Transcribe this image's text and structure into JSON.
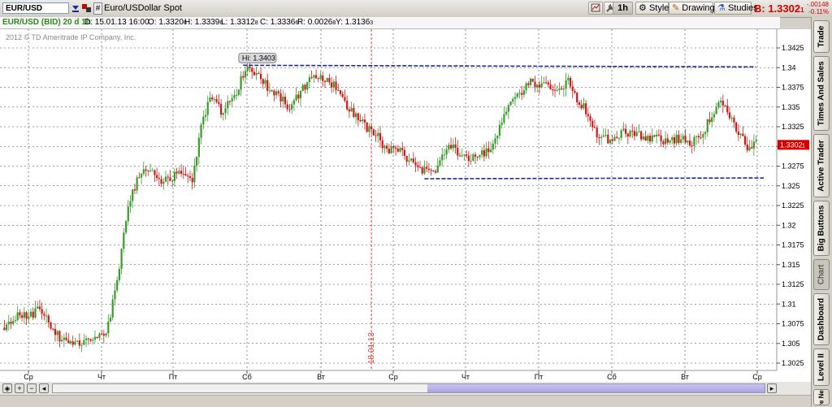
{
  "toolbar": {
    "symbol": "EUR/USD",
    "description": "Euro/USDollar Spot",
    "interval": "1h",
    "style_label": "Style",
    "drawings_label": "Drawings",
    "studies_label": "Studies",
    "bid": "B: 1.3302",
    "bid_suffix": "1",
    "change": "-.00148",
    "change_pct": "-0.11%"
  },
  "info": {
    "symbol_period": "EUR/USD (BID) 20 d 1h",
    "date": "D: 15.01.13 16:00",
    "open": "O: 1.3320",
    "open_suffix": "6",
    "high": "H: 1.3339",
    "high_suffix": "6",
    "low": "L: 1.3312",
    "low_suffix": "8",
    "close": "C: 1.3336",
    "close_suffix": "6",
    "range": "R: 0.0026",
    "range_suffix": "8",
    "y": "Y: 1.3136",
    "y_suffix": "3",
    "copyright": "2012 © TD Ameritrade IP Company, Inc."
  },
  "sidebar": {
    "tabs": [
      "Trade",
      "Times And Sales",
      "Active Trader",
      "Big Buttons",
      "Chart",
      "Dashboard",
      "Level II",
      "Live News"
    ]
  },
  "colors": {
    "up": "#3a9b2c",
    "down": "#d01818",
    "resistance": "#1a2a99",
    "marker": "#e04040",
    "price_tag": "#d40000"
  },
  "chart_data": {
    "type": "candlestick",
    "ylim": [
      1.3025,
      1.3425
    ],
    "y_ticks": [
      "1.3425",
      "1.34",
      "1.3375",
      "1.335",
      "1.3325",
      "1.33",
      "1.3275",
      "1.325",
      "1.3225",
      "1.32",
      "1.3175",
      "1.315",
      "1.3125",
      "1.31",
      "1.3075",
      "1.305",
      "1.3025"
    ],
    "x_ticks": [
      "Ср",
      "Чт",
      "Пт",
      "Сб",
      "Вт",
      "Ср",
      "Чт",
      "Пт",
      "Сб",
      "Вт",
      "Ср"
    ],
    "last_price": "1.3302",
    "last_price_suffix": "1",
    "high_label": "Hi: 1.3403",
    "resistance_level": 1.3403,
    "support_level": 1.3259,
    "date_marker": "18.01.13",
    "date_marker_bar": 166,
    "path": [
      [
        0,
        1.307
      ],
      [
        8,
        1.3088
      ],
      [
        14,
        1.3085
      ],
      [
        16,
        1.3092
      ],
      [
        20,
        1.308
      ],
      [
        26,
        1.3058
      ],
      [
        28,
        1.3052
      ],
      [
        34,
        1.305
      ],
      [
        40,
        1.3055
      ],
      [
        45,
        1.3057
      ],
      [
        48,
        1.3072
      ],
      [
        53,
        1.315
      ],
      [
        57,
        1.322
      ],
      [
        61,
        1.326
      ],
      [
        65,
        1.327
      ],
      [
        69,
        1.3262
      ],
      [
        74,
        1.3256
      ],
      [
        78,
        1.3262
      ],
      [
        82,
        1.3268
      ],
      [
        86,
        1.3252
      ],
      [
        90,
        1.3325
      ],
      [
        94,
        1.336
      ],
      [
        99,
        1.3346
      ],
      [
        103,
        1.3356
      ],
      [
        107,
        1.3376
      ],
      [
        110,
        1.34
      ],
      [
        114,
        1.3393
      ],
      [
        118,
        1.3382
      ],
      [
        122,
        1.337
      ],
      [
        126,
        1.336
      ],
      [
        130,
        1.335
      ],
      [
        135,
        1.3368
      ],
      [
        140,
        1.339
      ],
      [
        145,
        1.3384
      ],
      [
        150,
        1.3378
      ],
      [
        156,
        1.335
      ],
      [
        162,
        1.3336
      ],
      [
        166,
        1.332
      ],
      [
        170,
        1.3315
      ],
      [
        173,
        1.3295
      ],
      [
        177,
        1.3299
      ],
      [
        181,
        1.329
      ],
      [
        185,
        1.328
      ],
      [
        189,
        1.327
      ],
      [
        193,
        1.3275
      ],
      [
        196,
        1.3266
      ],
      [
        199,
        1.329
      ],
      [
        203,
        1.33
      ],
      [
        207,
        1.3292
      ],
      [
        211,
        1.3282
      ],
      [
        215,
        1.3286
      ],
      [
        219,
        1.3293
      ],
      [
        223,
        1.331
      ],
      [
        227,
        1.334
      ],
      [
        231,
        1.3356
      ],
      [
        235,
        1.337
      ],
      [
        239,
        1.338
      ],
      [
        243,
        1.3378
      ],
      [
        247,
        1.3378
      ],
      [
        252,
        1.3374
      ],
      [
        256,
        1.3382
      ],
      [
        260,
        1.336
      ],
      [
        264,
        1.3346
      ],
      [
        268,
        1.332
      ],
      [
        272,
        1.331
      ],
      [
        276,
        1.3308
      ],
      [
        280,
        1.3316
      ],
      [
        285,
        1.332
      ],
      [
        290,
        1.331
      ],
      [
        295,
        1.3312
      ],
      [
        300,
        1.3306
      ],
      [
        306,
        1.331
      ],
      [
        311,
        1.3305
      ],
      [
        316,
        1.3312
      ],
      [
        321,
        1.334
      ],
      [
        325,
        1.3356
      ],
      [
        329,
        1.334
      ],
      [
        333,
        1.3315
      ],
      [
        337,
        1.33
      ],
      [
        340,
        1.3302
      ]
    ],
    "bar_count": 341
  }
}
